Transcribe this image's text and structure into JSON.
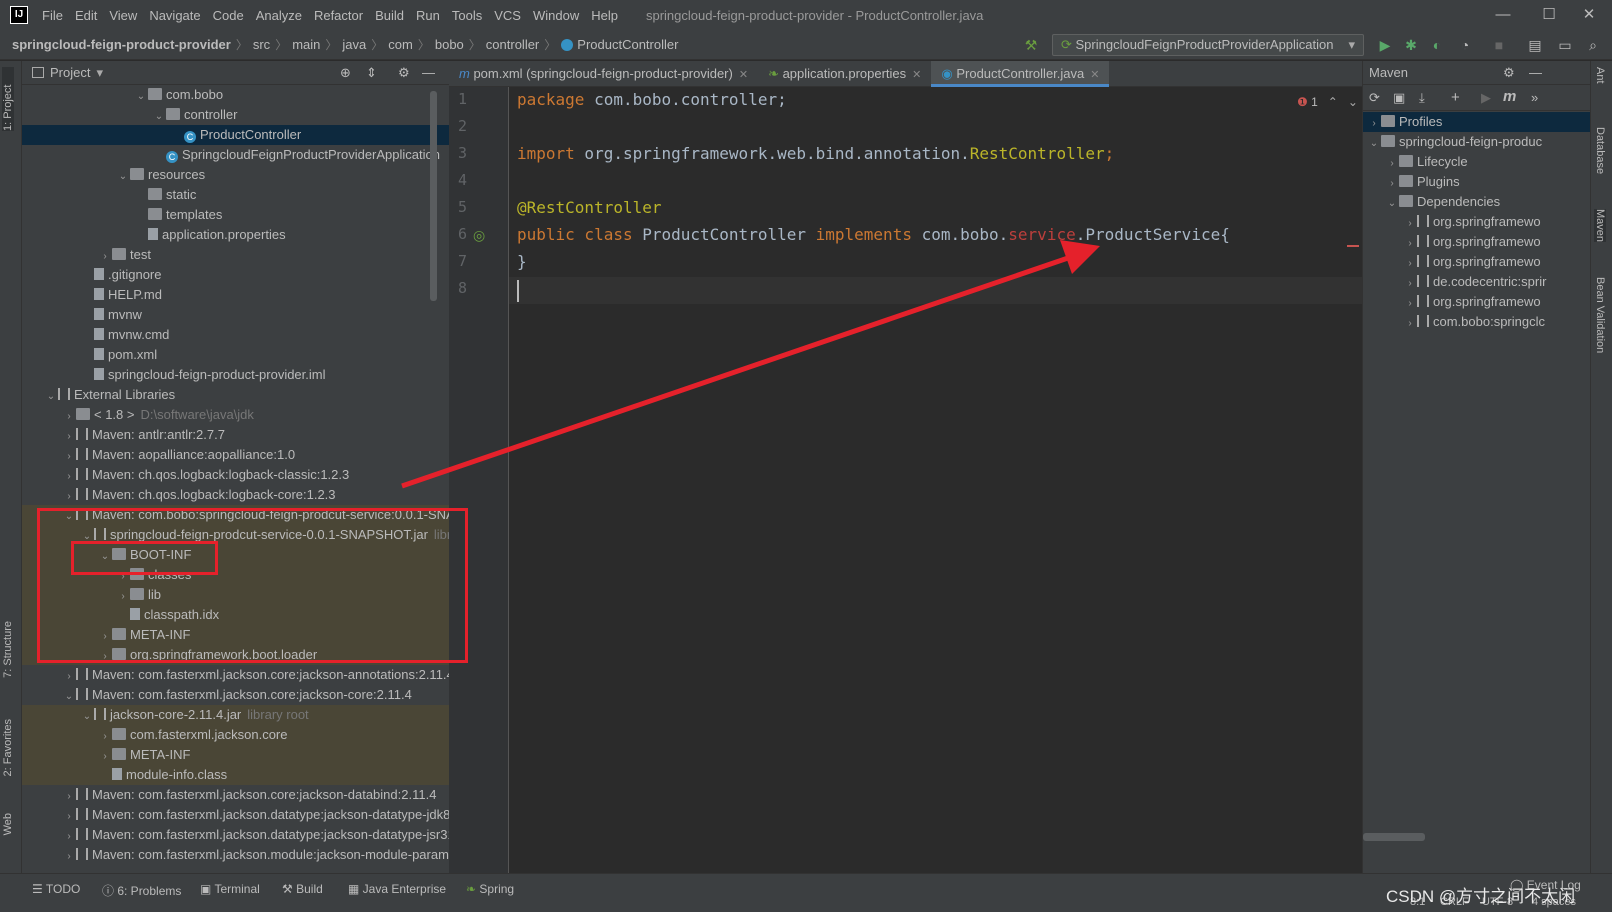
{
  "menubar": {
    "logo": "IJ",
    "items": [
      "File",
      "Edit",
      "View",
      "Navigate",
      "Code",
      "Analyze",
      "Refactor",
      "Build",
      "Run",
      "Tools",
      "VCS",
      "Window",
      "Help"
    ],
    "title": "springcloud-feign-product-provider - ProductController.java"
  },
  "navbar": {
    "crumbs": [
      "springcloud-feign-product-provider",
      "src",
      "main",
      "java",
      "com",
      "bobo",
      "controller",
      "ProductController"
    ],
    "run_config": "SpringcloudFeignProductProviderApplication"
  },
  "left_strip": {
    "project": "1: Project",
    "structure": "7: Structure",
    "favorites": "2: Favorites",
    "web": "Web"
  },
  "project": {
    "header": "Project",
    "rows": [
      {
        "indent": 5,
        "arrow": "⌄",
        "icon": "folder",
        "label": "com.bobo"
      },
      {
        "indent": 6,
        "arrow": "⌄",
        "icon": "folder",
        "label": "controller"
      },
      {
        "indent": 7,
        "arrow": "",
        "icon": "cls",
        "label": "ProductController",
        "selected": true
      },
      {
        "indent": 6,
        "arrow": "",
        "icon": "cls",
        "label": "SpringcloudFeignProductProviderApplication"
      },
      {
        "indent": 4,
        "arrow": "⌄",
        "icon": "folder",
        "label": "resources"
      },
      {
        "indent": 5,
        "arrow": "",
        "icon": "folder",
        "label": "static"
      },
      {
        "indent": 5,
        "arrow": "",
        "icon": "folder",
        "label": "templates"
      },
      {
        "indent": 5,
        "arrow": "",
        "icon": "file",
        "label": "application.properties"
      },
      {
        "indent": 3,
        "arrow": "›",
        "icon": "folder",
        "label": "test"
      },
      {
        "indent": 2,
        "arrow": "",
        "icon": "file",
        "label": ".gitignore"
      },
      {
        "indent": 2,
        "arrow": "",
        "icon": "file",
        "label": "HELP.md"
      },
      {
        "indent": 2,
        "arrow": "",
        "icon": "file",
        "label": "mvnw"
      },
      {
        "indent": 2,
        "arrow": "",
        "icon": "file",
        "label": "mvnw.cmd"
      },
      {
        "indent": 2,
        "arrow": "",
        "icon": "file",
        "label": "pom.xml"
      },
      {
        "indent": 2,
        "arrow": "",
        "icon": "file",
        "label": "springcloud-feign-product-provider.iml"
      },
      {
        "indent": 0,
        "arrow": "⌄",
        "icon": "lib",
        "label": "External Libraries"
      },
      {
        "indent": 1,
        "arrow": "›",
        "icon": "folder",
        "label": "< 1.8 >",
        "extra": "D:\\software\\java\\jdk"
      },
      {
        "indent": 1,
        "arrow": "›",
        "icon": "lib",
        "label": "Maven: antlr:antlr:2.7.7"
      },
      {
        "indent": 1,
        "arrow": "›",
        "icon": "lib",
        "label": "Maven: aopalliance:aopalliance:1.0"
      },
      {
        "indent": 1,
        "arrow": "›",
        "icon": "lib",
        "label": "Maven: ch.qos.logback:logback-classic:1.2.3"
      },
      {
        "indent": 1,
        "arrow": "›",
        "icon": "lib",
        "label": "Maven: ch.qos.logback:logback-core:1.2.3"
      },
      {
        "indent": 1,
        "arrow": "⌄",
        "icon": "lib",
        "label": "Maven: com.bobo:springcloud-feign-prodcut-service:0.0.1-SNA",
        "libroot": true
      },
      {
        "indent": 2,
        "arrow": "⌄",
        "icon": "lib",
        "label": "springcloud-feign-prodcut-service-0.0.1-SNAPSHOT.jar",
        "extra": "libra",
        "libroot": true
      },
      {
        "indent": 3,
        "arrow": "⌄",
        "icon": "folder",
        "label": "BOOT-INF",
        "libroot": true
      },
      {
        "indent": 4,
        "arrow": "›",
        "icon": "folder",
        "label": "classes",
        "libroot": true
      },
      {
        "indent": 4,
        "arrow": "›",
        "icon": "folder",
        "label": "lib",
        "libroot": true
      },
      {
        "indent": 4,
        "arrow": "",
        "icon": "file",
        "label": "classpath.idx",
        "libroot": true
      },
      {
        "indent": 3,
        "arrow": "›",
        "icon": "folder",
        "label": "META-INF",
        "libroot": true
      },
      {
        "indent": 3,
        "arrow": "›",
        "icon": "folder",
        "label": "org.springframework.boot.loader",
        "libroot": true
      },
      {
        "indent": 1,
        "arrow": "›",
        "icon": "lib",
        "label": "Maven: com.fasterxml.jackson.core:jackson-annotations:2.11.4"
      },
      {
        "indent": 1,
        "arrow": "⌄",
        "icon": "lib",
        "label": "Maven: com.fasterxml.jackson.core:jackson-core:2.11.4"
      },
      {
        "indent": 2,
        "arrow": "⌄",
        "icon": "lib",
        "label": "jackson-core-2.11.4.jar",
        "extra": "library root",
        "libroot": true
      },
      {
        "indent": 3,
        "arrow": "›",
        "icon": "folder",
        "label": "com.fasterxml.jackson.core",
        "libroot": true
      },
      {
        "indent": 3,
        "arrow": "›",
        "icon": "folder",
        "label": "META-INF",
        "libroot": true
      },
      {
        "indent": 3,
        "arrow": "",
        "icon": "file",
        "label": "module-info.class",
        "libroot": true
      },
      {
        "indent": 1,
        "arrow": "›",
        "icon": "lib",
        "label": "Maven: com.fasterxml.jackson.core:jackson-databind:2.11.4"
      },
      {
        "indent": 1,
        "arrow": "›",
        "icon": "lib",
        "label": "Maven: com.fasterxml.jackson.datatype:jackson-datatype-jdk8:2"
      },
      {
        "indent": 1,
        "arrow": "›",
        "icon": "lib",
        "label": "Maven: com.fasterxml.jackson.datatype:jackson-datatype-jsr310"
      },
      {
        "indent": 1,
        "arrow": "›",
        "icon": "lib",
        "label": "Maven: com.fasterxml.jackson.module:jackson-module-parame"
      }
    ]
  },
  "editor": {
    "tabs": [
      {
        "label": "pom.xml (springcloud-feign-product-provider)",
        "icon": "m"
      },
      {
        "label": "application.properties",
        "icon": "leaf"
      },
      {
        "label": "ProductController.java",
        "icon": "c",
        "active": true
      }
    ],
    "error_count": "1",
    "line_numbers": [
      "1",
      "2",
      "3",
      "4",
      "5",
      "6",
      "7",
      "8"
    ]
  },
  "code": {
    "l1_kw": "package",
    "l1_rest": " com.bobo.controller;",
    "l3_kw": "import",
    "l3_pkg": " org.springframework.web.bind.annotation.",
    "l3_cls": "RestController",
    "l3_end": ";",
    "l5_ann": "@RestController",
    "l6_kw1": "public class",
    "l6_name": " ProductController ",
    "l6_kw2": "implements",
    "l6_pre": " com.bobo.",
    "l6_err": "service",
    "l6_post": ".ProductService{",
    "l7": "}"
  },
  "maven": {
    "header": "Maven",
    "rows": [
      {
        "indent": 0,
        "arrow": "›",
        "label": "Profiles",
        "selected": true
      },
      {
        "indent": 0,
        "arrow": "⌄",
        "label": "springcloud-feign-produc"
      },
      {
        "indent": 1,
        "arrow": "›",
        "label": "Lifecycle"
      },
      {
        "indent": 1,
        "arrow": "›",
        "label": "Plugins"
      },
      {
        "indent": 1,
        "arrow": "⌄",
        "label": "Dependencies"
      },
      {
        "indent": 2,
        "arrow": "›",
        "label": "org.springframewo"
      },
      {
        "indent": 2,
        "arrow": "›",
        "label": "org.springframewo"
      },
      {
        "indent": 2,
        "arrow": "›",
        "label": "org.springframewo"
      },
      {
        "indent": 2,
        "arrow": "›",
        "label": "de.codecentric:sprir"
      },
      {
        "indent": 2,
        "arrow": "›",
        "label": "org.springframewo"
      },
      {
        "indent": 2,
        "arrow": "›",
        "label": "com.bobo:springclc"
      }
    ]
  },
  "right_strip": {
    "ant": "Ant",
    "database": "Database",
    "maven": "Maven",
    "bean": "Bean Validation"
  },
  "statusbar": {
    "todo": "TODO",
    "problems": "6: Problems",
    "terminal": "Terminal",
    "build": "Build",
    "java_ent": "Java Enterprise",
    "spring": "Spring",
    "event_log": "Event Log",
    "position": "8:1",
    "line_sep": "CRLF",
    "encoding": "UTF-8",
    "indent": "4 spaces",
    "watermark": "CSDN @方寸之间不太闲"
  },
  "colors": {
    "annotation": "#e5212b",
    "selection": "#0d293e",
    "accent": "#4a88c7"
  }
}
